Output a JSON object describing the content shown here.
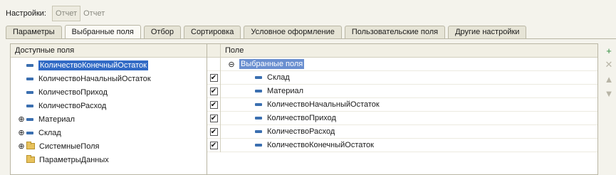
{
  "settings": {
    "label": "Настройки:",
    "report_box": "Отчет",
    "report_text": "Отчет"
  },
  "tabs": [
    {
      "label": "Параметры"
    },
    {
      "label": "Выбранные поля"
    },
    {
      "label": "Отбор"
    },
    {
      "label": "Сортировка"
    },
    {
      "label": "Условное оформление"
    },
    {
      "label": "Пользовательские поля"
    },
    {
      "label": "Другие настройки"
    }
  ],
  "left_panel": {
    "header": "Доступные поля",
    "items": [
      {
        "label": "КоличествоКонечныйОстаток"
      },
      {
        "label": "КоличествоНачальныйОстаток"
      },
      {
        "label": "КоличествоПриход"
      },
      {
        "label": "КоличествоРасход"
      },
      {
        "label": "Материал"
      },
      {
        "label": "Склад"
      },
      {
        "label": "СистемныеПоля"
      },
      {
        "label": "ПараметрыДанных"
      }
    ]
  },
  "right_panel": {
    "header": "Поле",
    "group_label": "Выбранные поля",
    "items": [
      {
        "label": "Склад"
      },
      {
        "label": "Материал"
      },
      {
        "label": "КоличествоНачальныйОстаток"
      },
      {
        "label": "КоличествоПриход"
      },
      {
        "label": "КоличествоРасход"
      },
      {
        "label": "КоличествоКонечныйОстаток"
      }
    ]
  },
  "glyphs": {
    "plus": "⊕",
    "minus": "⊖",
    "check": "✔",
    "add": "+",
    "delete": "✕",
    "up": "▲",
    "down": "▼"
  },
  "colors": {
    "selection": "#316ac5",
    "field_icon": "#3b6fb0",
    "add_icon": "#2e8b3a"
  }
}
